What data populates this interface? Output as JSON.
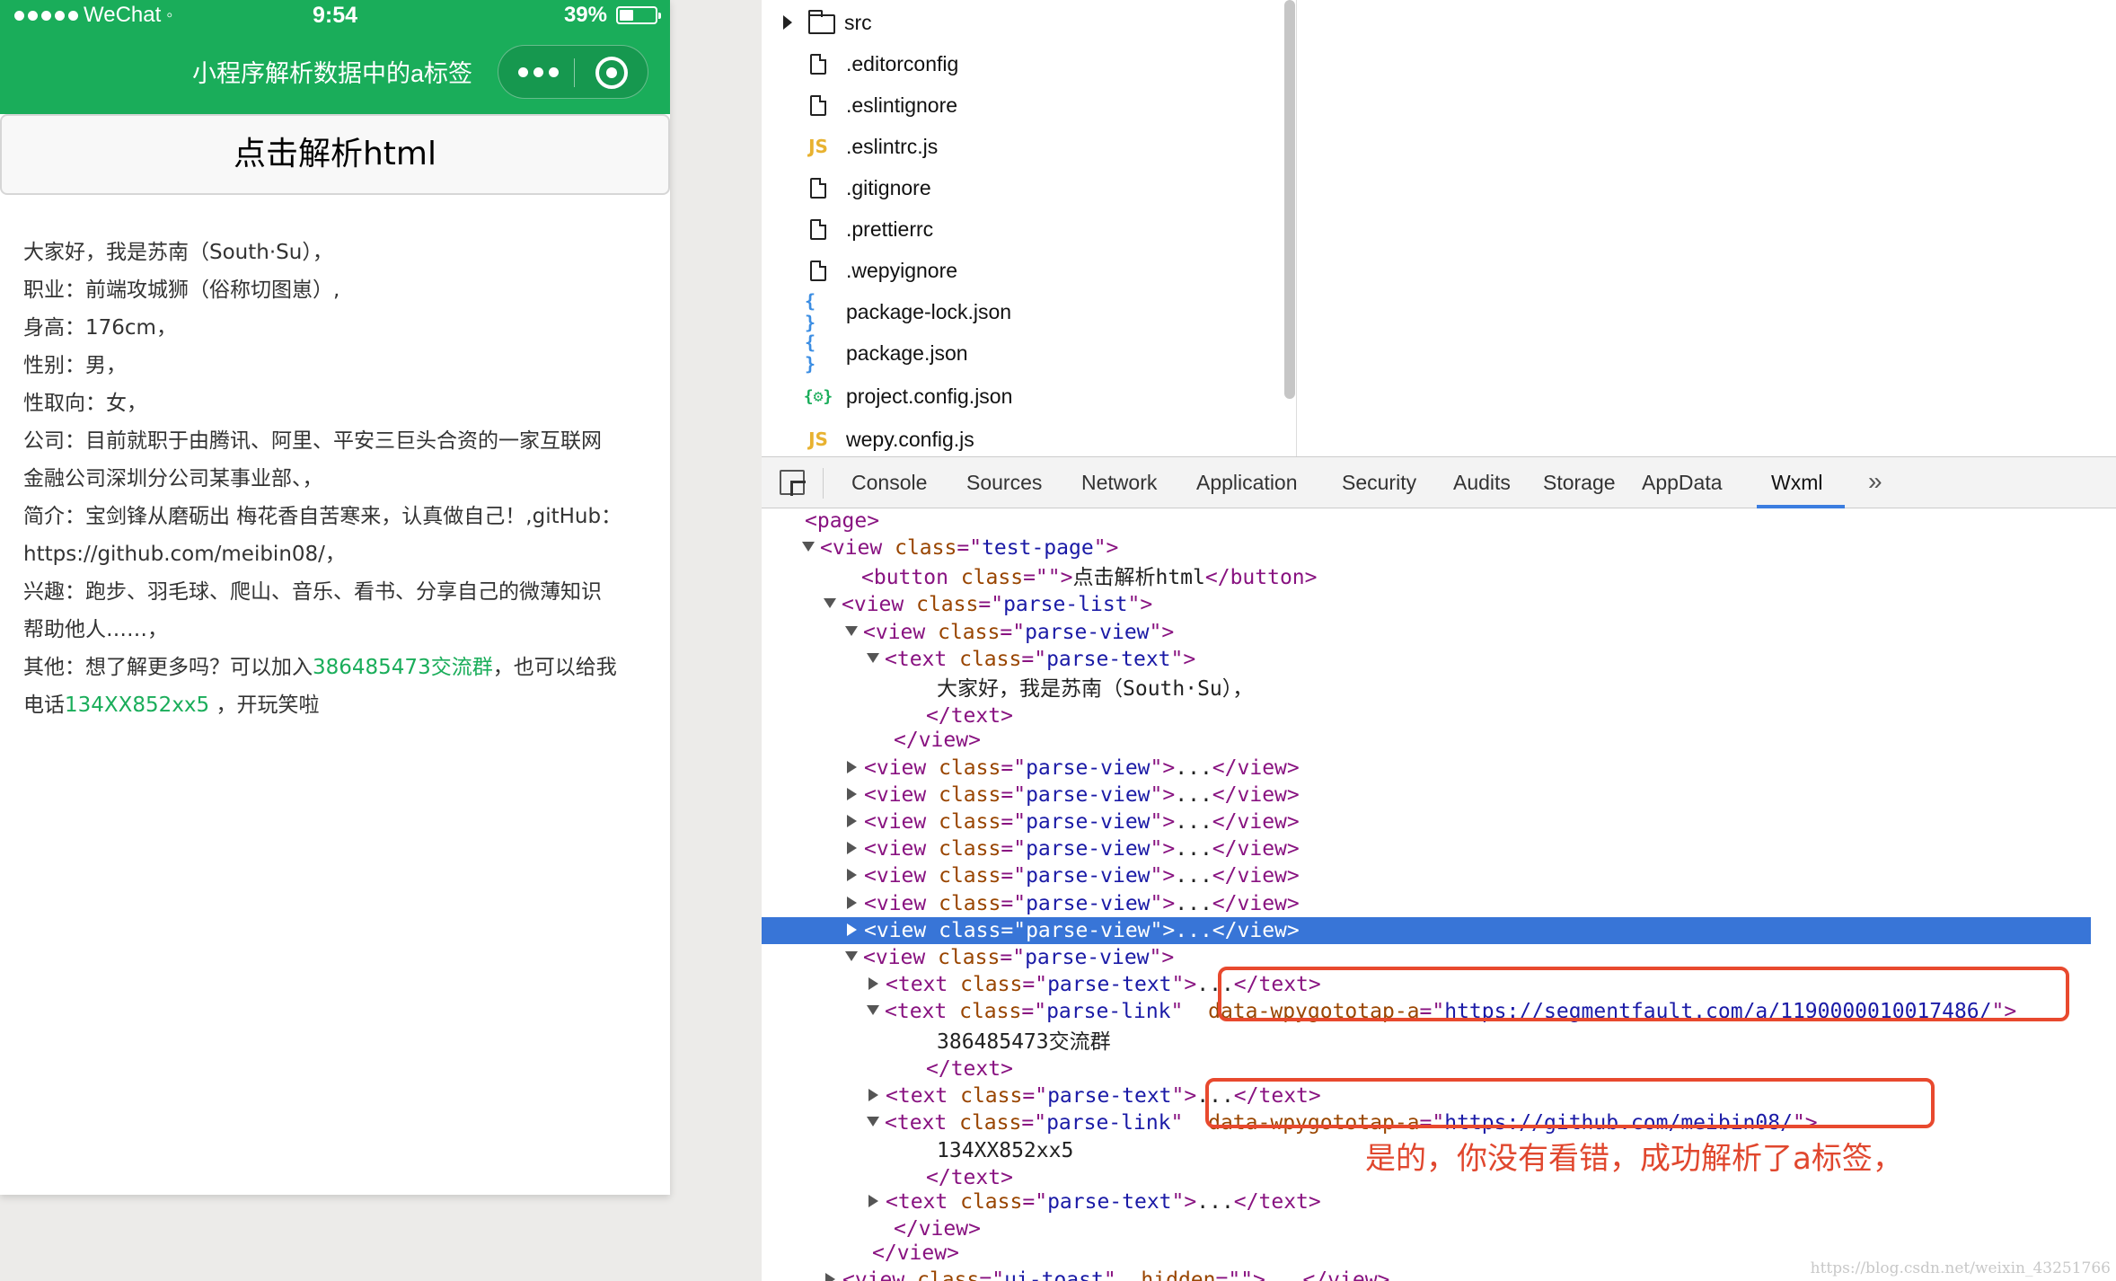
{
  "status_bar": {
    "carrier": "WeChat",
    "time": "9:54",
    "battery": "39%",
    "battery_level": 0.39
  },
  "nav": {
    "title": "小程序解析数据中的a标签"
  },
  "page": {
    "button_label": "点击解析html",
    "lines": [
      {
        "text": "大家好，我是苏南（South·Su），"
      },
      {
        "text": "职业：前端攻城狮（俗称切图崽）,"
      },
      {
        "text": "身高：176cm，"
      },
      {
        "text": "性别：男，"
      },
      {
        "text": "性取向：女，"
      },
      {
        "text": "公司：目前就职于由腾讯、阿里、平安三巨头合资的一家互联网"
      },
      {
        "text": "金融公司深圳分公司某事业部、，"
      },
      {
        "text": "简介：宝剑锋从磨砺出 梅花香自苦寒来，认真做自己！,gitHub："
      },
      {
        "text": "https://github.com/meibin08/，"
      },
      {
        "text": "兴趣：跑步、羽毛球、爬山、音乐、看书、分享自己的微薄知识"
      },
      {
        "text": "帮助他人……，"
      }
    ],
    "other_prefix": "其他：想了解更多吗？可以加入",
    "other_link": "386485473交流群",
    "other_suffix": "，也可以给我",
    "phone_prefix": "电话",
    "phone_link": "134XX852xx5",
    "phone_suffix": " ，开玩笑啦"
  },
  "file_tree": [
    {
      "name": "src",
      "icon": "folder-icon"
    },
    {
      "name": ".editorconfig",
      "icon": "file-icon"
    },
    {
      "name": ".eslintignore",
      "icon": "file-icon"
    },
    {
      "name": ".eslintrc.js",
      "icon": "js-file-icon"
    },
    {
      "name": ".gitignore",
      "icon": "file-icon"
    },
    {
      "name": ".prettierrc",
      "icon": "file-icon"
    },
    {
      "name": ".wepyignore",
      "icon": "file-icon"
    },
    {
      "name": "package-lock.json",
      "icon": "json-file-icon"
    },
    {
      "name": "package.json",
      "icon": "json-file-icon"
    },
    {
      "name": "project.config.json",
      "icon": "config-json-icon"
    },
    {
      "name": "wepy.config.js",
      "icon": "js-file-icon"
    }
  ],
  "icons": {
    "js": "JS",
    "json": "{ }",
    "config_json": "{⚙}"
  },
  "devtools_tabs": [
    "Console",
    "Sources",
    "Network",
    "Application",
    "Security",
    "Audits",
    "Storage",
    "AppData",
    "Wxml"
  ],
  "active_tab": "Wxml",
  "tabs_more": "»",
  "dom": {
    "page_tag": "page",
    "test_page_class": "test-page",
    "button_text": "点击解析html",
    "parse_list_class": "parse-list",
    "parse_view_class": "parse-view",
    "parse_text_class": "parse-text",
    "parse_link_class": "parse-link",
    "first_text": "大家好，我是苏南（South·Su），",
    "link1_attr": "data-wpygototap-a",
    "link1_url": "https://segmentfault.com/a/1190000010017486/",
    "link1_text": "386485473交流群",
    "link2_attr": "data-wpygototap-a",
    "link2_url": "https://github.com/meibin08/",
    "link2_text": "134XX852xx5",
    "toast_class": "ui-toast",
    "modal_class": "ui-modal",
    "hidden_attr": "hidden"
  },
  "annotation": "是的，你没有看错，成功解析了a标签，",
  "watermark": "https://blog.csdn.net/weixin_43251766",
  "colors": {
    "wechat_green": "#1aad5a",
    "selection": "#3875d7",
    "highlight_red": "#e8492e",
    "tab_accent": "#3b7de0"
  }
}
